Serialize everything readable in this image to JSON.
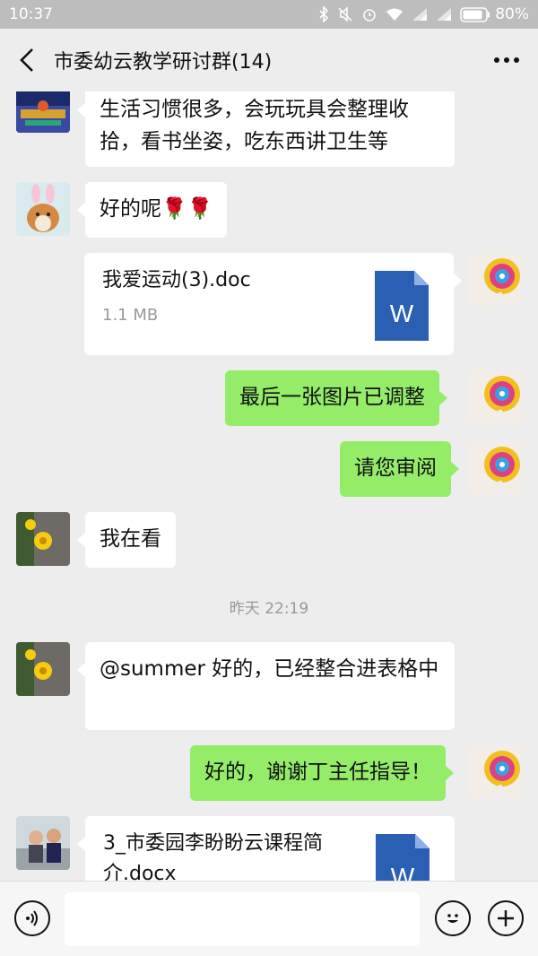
{
  "status": {
    "time": "10:37",
    "battery": "80%"
  },
  "header": {
    "title": "市委幼云教学研讨群(14)"
  },
  "messages": {
    "m1": {
      "text": "生活习惯很多，会玩玩具会整理收拾，看书坐姿，吃东西讲卫生等"
    },
    "m2": {
      "text": "好的呢🌹🌹"
    },
    "m3": {
      "file_name": "我爱运动(3).doc",
      "file_size": "1.1 MB",
      "icon_letter": "W"
    },
    "m4": {
      "text": "最后一张图片已调整"
    },
    "m5": {
      "text": "请您审阅"
    },
    "m6": {
      "text": "我在看"
    },
    "ts": {
      "text": "昨天 22:19"
    },
    "m7": {
      "text": "@summer 好的，已经整合进表格中"
    },
    "m8": {
      "text": "好的，谢谢丁主任指导！"
    },
    "m9": {
      "file_name": "3_市委园李盼盼云课程简介.docx",
      "icon_letter": "W"
    }
  },
  "colors": {
    "green_bubble": "#95ec69",
    "word_blue": "#2b5fb4"
  }
}
